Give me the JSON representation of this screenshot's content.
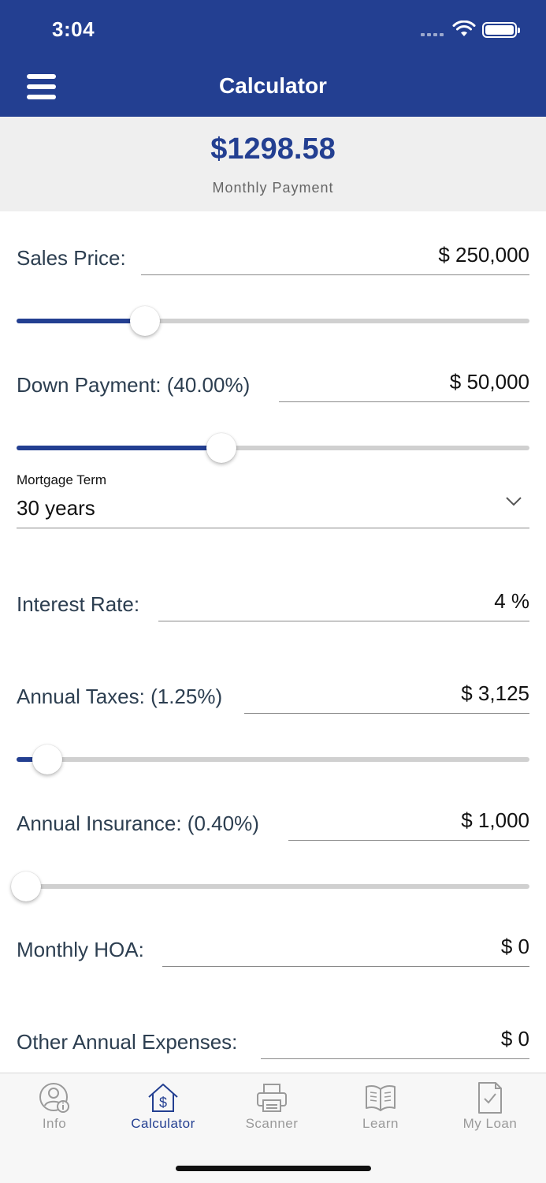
{
  "status": {
    "time": "3:04"
  },
  "header": {
    "title": "Calculator"
  },
  "summary": {
    "amount": "$1298.58",
    "label": "Monthly Payment"
  },
  "fields": {
    "sales_price": {
      "label": "Sales Price:",
      "value": "$ 250,000",
      "slider_percent": 25
    },
    "down_payment": {
      "label": "Down Payment: (40.00%)",
      "value": "$ 50,000",
      "slider_percent": 40
    },
    "mortgage_term": {
      "label": "Mortgage Term",
      "value": "30 years"
    },
    "interest_rate": {
      "label": "Interest Rate:",
      "value": "4 %"
    },
    "annual_taxes": {
      "label": "Annual Taxes: (1.25%)",
      "value": "$ 3,125",
      "slider_percent": 6
    },
    "annual_insurance": {
      "label": "Annual Insurance: (0.40%)",
      "value": "$ 1,000",
      "slider_percent": 0
    },
    "monthly_hoa": {
      "label": "Monthly HOA:",
      "value": "$ 0"
    },
    "other_expenses": {
      "label": "Other Annual Expenses:",
      "value": "$ 0"
    }
  },
  "tabs": [
    {
      "label": "Info",
      "icon": "user-info-icon",
      "active": false
    },
    {
      "label": "Calculator",
      "icon": "house-dollar-icon",
      "active": true
    },
    {
      "label": "Scanner",
      "icon": "printer-icon",
      "active": false
    },
    {
      "label": "Learn",
      "icon": "book-icon",
      "active": false
    },
    {
      "label": "My Loan",
      "icon": "document-check-icon",
      "active": false
    }
  ],
  "colors": {
    "primary": "#233f91",
    "summary_bg": "#efefef",
    "inactive": "#9a9a9a"
  }
}
